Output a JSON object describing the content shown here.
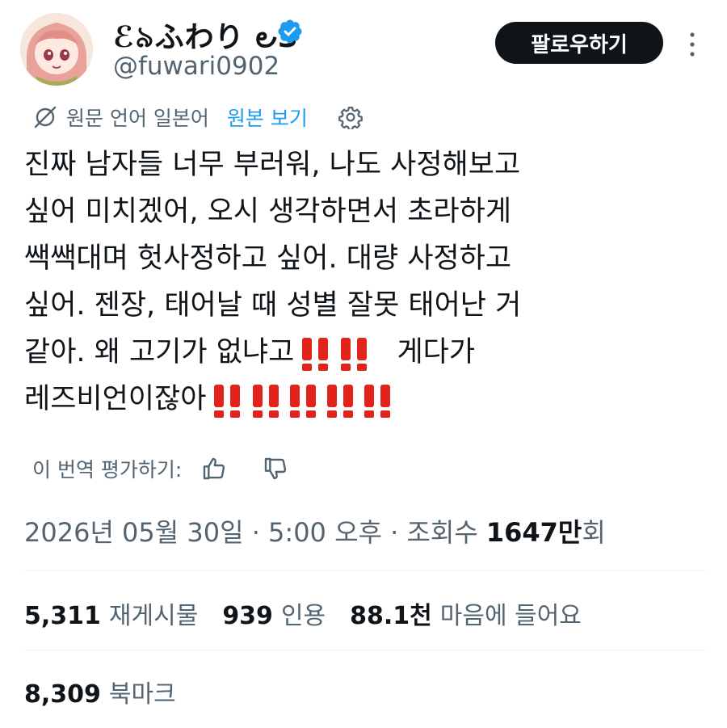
{
  "user": {
    "display_name": "ℰ৯ふわり ౿3",
    "handle": "@fuwari0902",
    "verified": true,
    "avatar_icon": "avatar-anime-girl",
    "follow_label": "팔로우하기"
  },
  "translation": {
    "source_label": "원문 언어 일본어",
    "show_original_label": "원본 보기",
    "icon": "translate-slash-icon"
  },
  "tweet": {
    "lines": [
      "진짜 남자들 너무 부러워, 나도 사정해보고",
      "싶어 미치겠어, 오시 생각하면서 초라하게",
      "쌕쌕대며 헛사정하고 싶어. 대량 사정하고",
      "싶어. 젠장, 태어날 때 성별 잘못 태어난 거",
      "같아. 왜 고기가 없냐고",
      "레즈비언이잖아"
    ],
    "line5_after": "게다가",
    "emoji_double_exclamation": "‼️",
    "emoji_color": "#e1231c"
  },
  "rate": {
    "label": "이 번역 평가하기:"
  },
  "meta": {
    "timestamp": "2026년 05월 30일 · 5:00 오후 · 조회수",
    "views_number": "1647만",
    "views_suffix": "회"
  },
  "stats": {
    "reposts_num": "5,311",
    "reposts_label": "재게시물",
    "quotes_num": "939",
    "quotes_label": "인용",
    "likes_num": "88.1천",
    "likes_label": "마음에 들어요",
    "bookmarks_num": "8,309",
    "bookmarks_label": "북마크"
  },
  "colors": {
    "text": "#0f1419",
    "secondary": "#536471",
    "link": "#1d9bf0",
    "verified": "#1d9bf0",
    "button_bg": "#0f1419"
  }
}
